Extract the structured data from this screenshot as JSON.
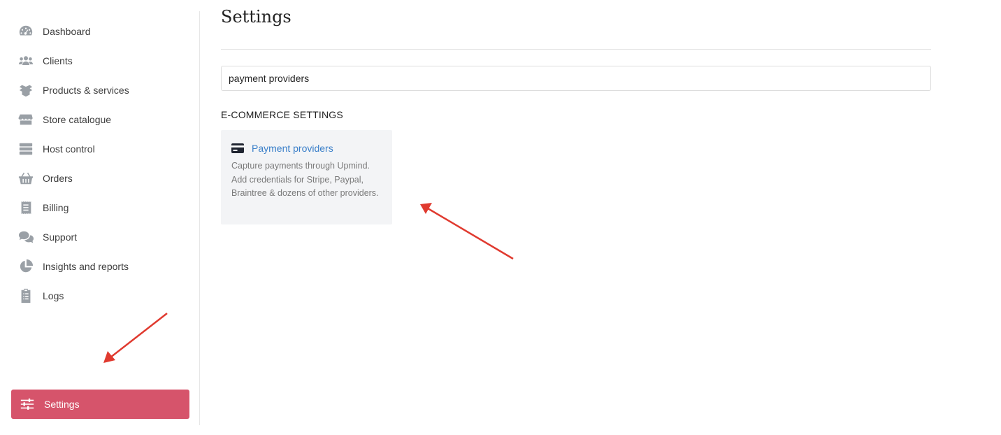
{
  "sidebar": {
    "items": [
      {
        "label": "Dashboard",
        "icon": "dashboard-icon"
      },
      {
        "label": "Clients",
        "icon": "users-icon"
      },
      {
        "label": "Products & services",
        "icon": "boxes-icon"
      },
      {
        "label": "Store catalogue",
        "icon": "store-icon"
      },
      {
        "label": "Host control",
        "icon": "server-icon"
      },
      {
        "label": "Orders",
        "icon": "basket-icon"
      },
      {
        "label": "Billing",
        "icon": "receipt-icon"
      },
      {
        "label": "Support",
        "icon": "chat-icon"
      },
      {
        "label": "Insights and reports",
        "icon": "pie-chart-icon"
      },
      {
        "label": "Logs",
        "icon": "clipboard-icon"
      }
    ],
    "settings": {
      "label": "Settings",
      "icon": "sliders-icon",
      "active": true
    }
  },
  "main": {
    "title": "Settings",
    "search": {
      "value": "payment providers",
      "placeholder": ""
    },
    "section_heading": "E-COMMERCE SETTINGS",
    "card": {
      "title": "Payment providers",
      "icon": "credit-card-icon",
      "description": "Capture payments through Upmind. Add credentials for Stripe, Paypal, Braintree & dozens of other providers."
    }
  },
  "colors": {
    "accent": "#d6546b",
    "link": "#3a7fc9",
    "icon_gray": "#9aa0a6",
    "annotation_arrow": "#e03a2f"
  }
}
